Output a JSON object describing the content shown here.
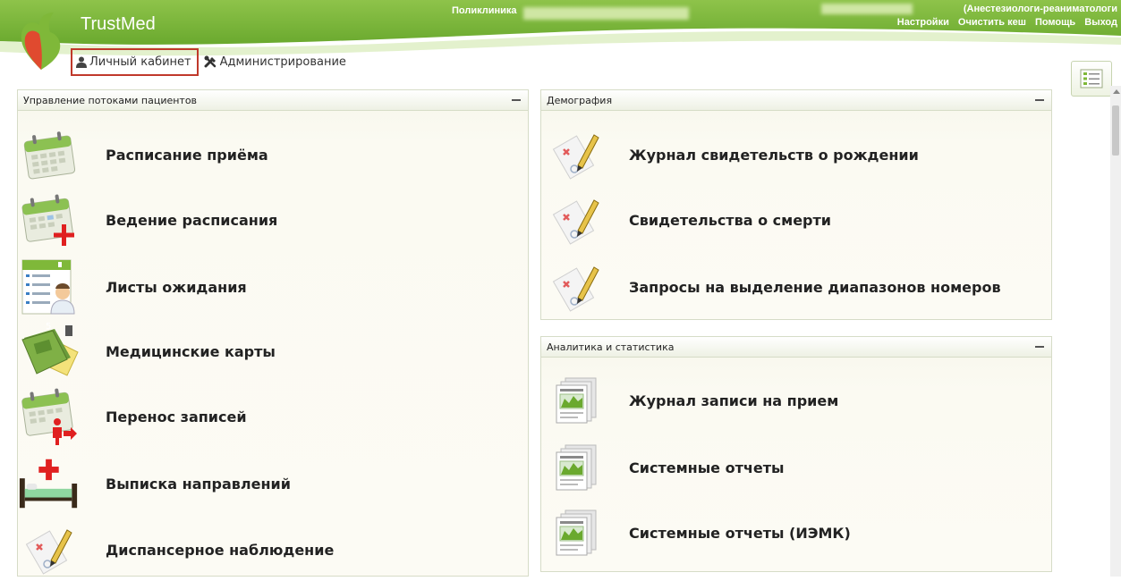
{
  "colors": {
    "brand_green": "#7fb839",
    "brand_red": "#e04a2f",
    "accent_red": "#e02020",
    "box_border": "#c0392b"
  },
  "header": {
    "brand": "TrustMed",
    "clinic_label": "Поликлиника",
    "user_role": "(Анестезиологи-реаниматологи",
    "links": [
      "Настройки",
      "Очистить кеш",
      "Помощь",
      "Выход"
    ]
  },
  "nav": {
    "personal_cabinet": "Личный кабинет",
    "administration": "Администрирование"
  },
  "panels": {
    "patient_flow": {
      "title": "Управление потоками пациентов",
      "items": [
        {
          "label": "Расписание приёма",
          "icon": "calendar-icon"
        },
        {
          "label": "Ведение расписания",
          "icon": "calendar-add-icon"
        },
        {
          "label": "Листы ожидания",
          "icon": "waiting-list-icon"
        },
        {
          "label": "Медицинские карты",
          "icon": "medical-card-icon"
        },
        {
          "label": "Перенос записей",
          "icon": "calendar-transfer-icon"
        },
        {
          "label": "Выписка направлений",
          "icon": "hospital-bed-icon"
        },
        {
          "label": "Диспансерное наблюдение",
          "icon": "document-edit-icon"
        }
      ]
    },
    "demography": {
      "title": "Демография",
      "items": [
        {
          "label": "Журнал свидетельств о рождении",
          "icon": "document-edit-icon"
        },
        {
          "label": "Свидетельства о смерти",
          "icon": "document-edit-icon"
        },
        {
          "label": "Запросы на выделение диапазонов номеров",
          "icon": "document-edit-icon"
        }
      ]
    },
    "analytics": {
      "title": "Аналитика и статистика",
      "items": [
        {
          "label": "Журнал записи на прием",
          "icon": "report-chart-icon"
        },
        {
          "label": "Системные отчеты",
          "icon": "report-chart-icon"
        },
        {
          "label": "Системные отчеты (ИЭМК)",
          "icon": "report-chart-icon"
        }
      ]
    }
  }
}
